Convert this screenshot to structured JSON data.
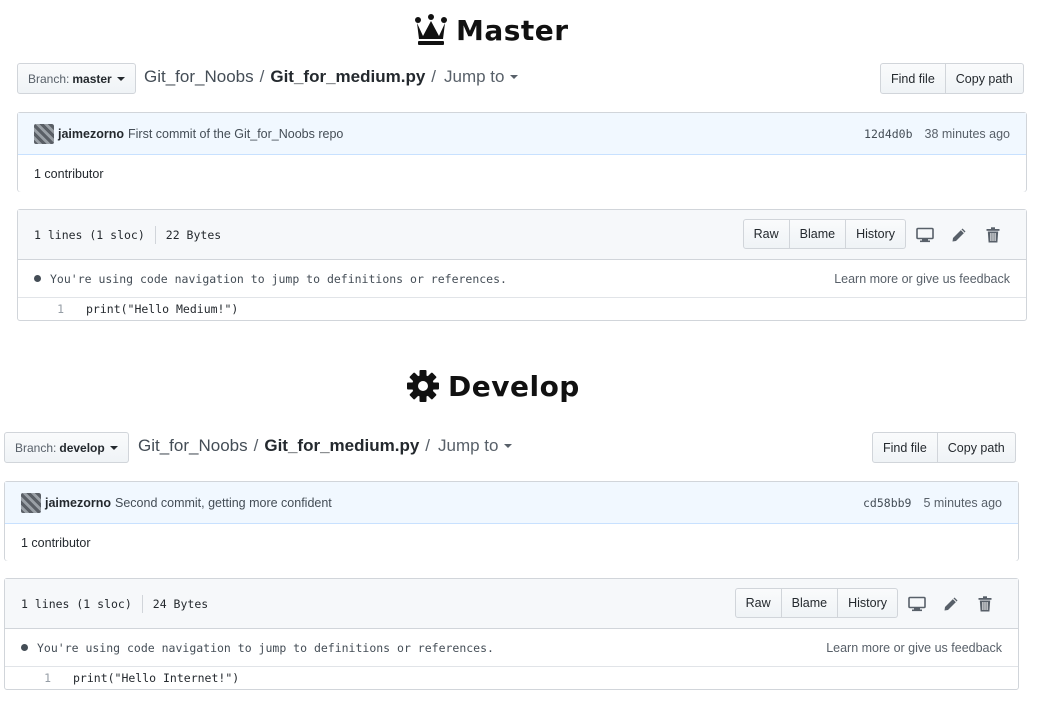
{
  "sections": [
    {
      "title": "Master",
      "title_icon": "crown-icon",
      "branch_label": "Branch:",
      "branch_name": "master",
      "repo": "Git_for_Noobs",
      "separator": "/",
      "file_name": "Git_for_medium.py",
      "jump_to": "Jump to",
      "find_file": "Find file",
      "copy_path": "Copy path",
      "author": "jaimezorno",
      "commit_message": "First commit of the Git_for_Noobs repo",
      "commit_sha": "12d4d0b",
      "commit_time": "38 minutes ago",
      "contributors": "1 contributor",
      "lines_info": "1 lines (1 sloc)",
      "size_info": "22 Bytes",
      "raw": "Raw",
      "blame": "Blame",
      "history": "History",
      "nav_message": "You're using code navigation to jump to definitions or references.",
      "nav_link": "Learn more or give us feedback",
      "line_number": "1",
      "code_line": "print(\"Hello Medium!\")"
    },
    {
      "title": "Develop",
      "title_icon": "gear-icon",
      "branch_label": "Branch:",
      "branch_name": "develop",
      "repo": "Git_for_Noobs",
      "separator": "/",
      "file_name": "Git_for_medium.py",
      "jump_to": "Jump to",
      "find_file": "Find file",
      "copy_path": "Copy path",
      "author": "jaimezorno",
      "commit_message": "Second commit, getting more confident",
      "commit_sha": "cd58bb9",
      "commit_time": "5 minutes ago",
      "contributors": "1 contributor",
      "lines_info": "1 lines (1 sloc)",
      "size_info": "24 Bytes",
      "raw": "Raw",
      "blame": "Blame",
      "history": "History",
      "nav_message": "You're using code navigation to jump to definitions or references.",
      "nav_link": "Learn more or give us feedback",
      "line_number": "1",
      "code_line": "print(\"Hello Internet!\")"
    }
  ],
  "icons": {
    "display": "desktop-icon",
    "edit": "pencil-icon",
    "delete": "trash-icon"
  }
}
